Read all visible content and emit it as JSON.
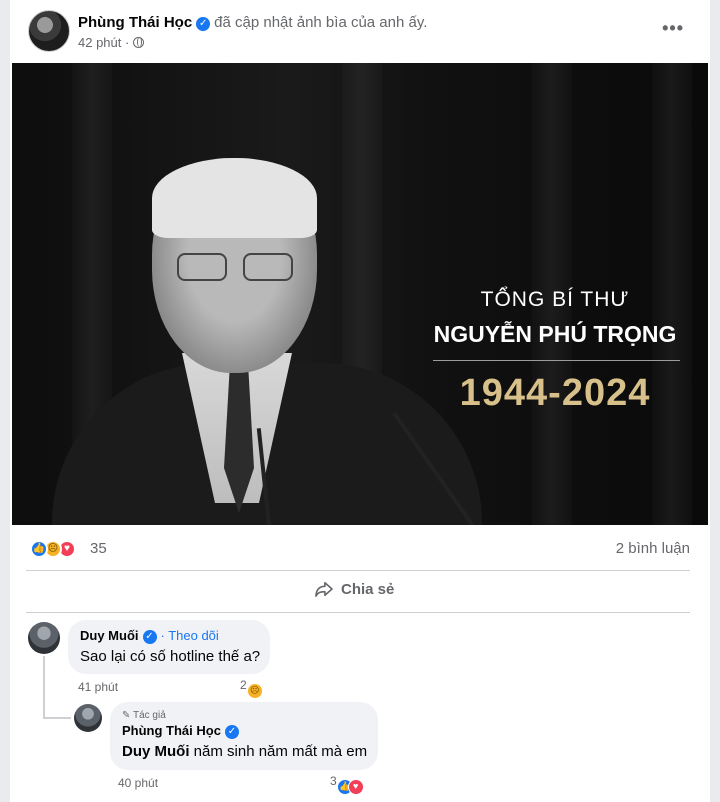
{
  "post": {
    "author": "Phùng Thái Học",
    "action": "đã cập nhật ảnh bìa của anh ấy.",
    "time": "42 phút",
    "privacy_icon": "globe-icon",
    "more_label": "•••"
  },
  "cover": {
    "title": "TỔNG BÍ THƯ",
    "name": "NGUYỄN PHÚ TRỌNG",
    "years": "1944-2024",
    "years_color": "#d7c08a"
  },
  "reactions": {
    "icons": [
      "like-icon",
      "sad-icon",
      "love-icon"
    ],
    "count": "35",
    "comments": "2 bình luận"
  },
  "actions": {
    "share_label": "Chia sẻ"
  },
  "comments": [
    {
      "name": "Duy Muối",
      "follow": "· Theo dõi",
      "text": "Sao lại có số hotline thế a?",
      "time": "41 phút",
      "reaction_count": "2"
    }
  ],
  "reply": {
    "author_tag": "Tác giả",
    "name": "Phùng Thái Học",
    "mention": "Duy Muối",
    "text": " năm sinh năm mất mà em",
    "time": "40 phút",
    "reaction_count": "3"
  },
  "colors": {
    "brand_blue": "#1877f2",
    "secondary_text": "#65676b",
    "bubble": "#f0f2f5"
  }
}
